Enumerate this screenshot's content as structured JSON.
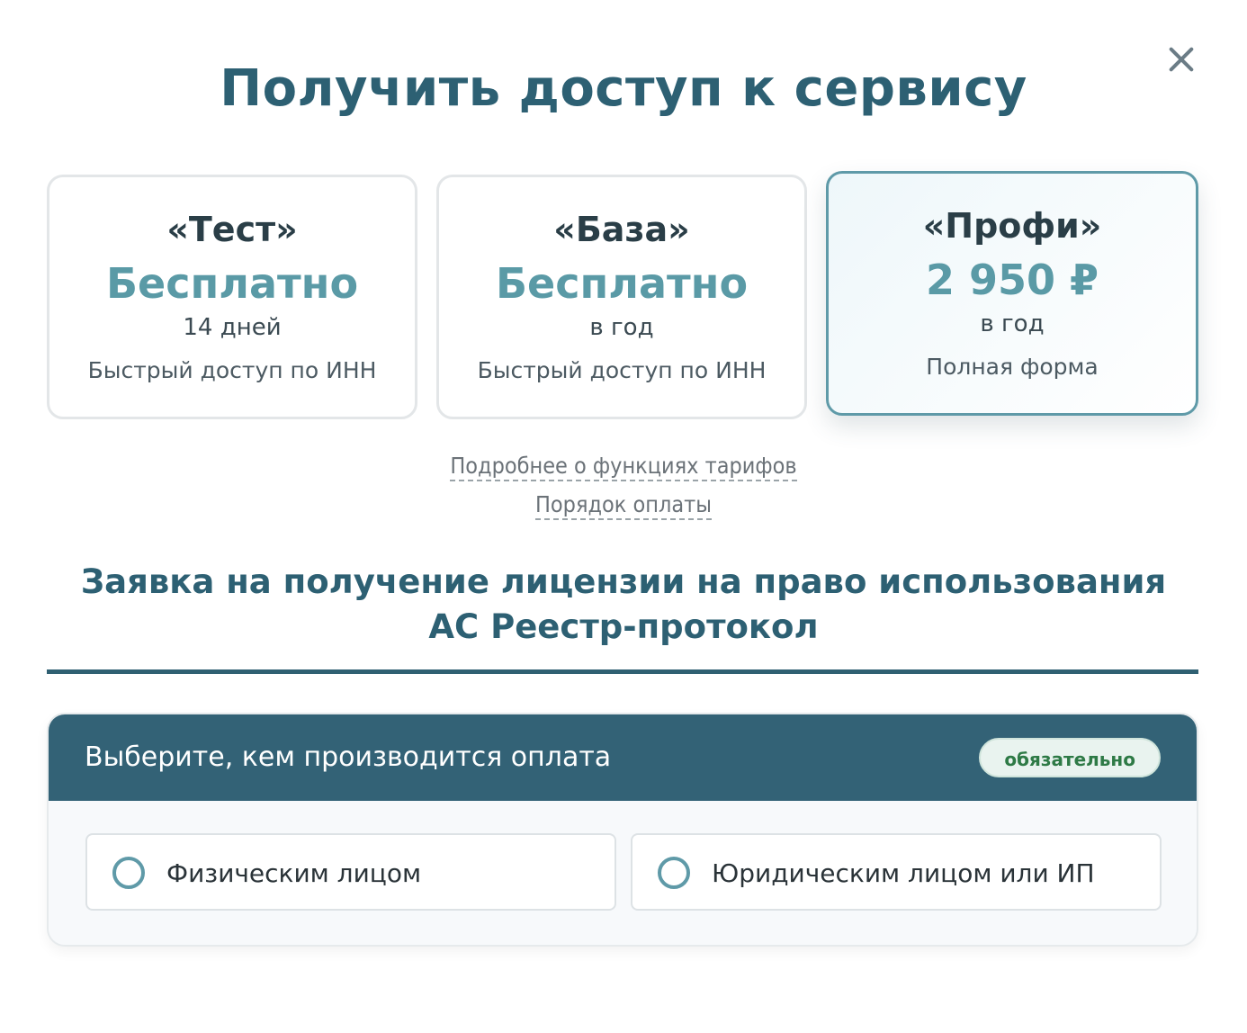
{
  "modal": {
    "title": "Получить доступ к сервису",
    "close_icon": "close-icon"
  },
  "plans": [
    {
      "name": "«Тест»",
      "price": "Бесплатно",
      "period": "14 дней",
      "desc": "Быстрый доступ по ИНН",
      "selected": false
    },
    {
      "name": "«База»",
      "price": "Бесплатно",
      "period": "в год",
      "desc": "Быстрый доступ по ИНН",
      "selected": false
    },
    {
      "name": "«Профи»",
      "price": "2 950 ₽",
      "period": "в год",
      "desc": "Полная форма",
      "selected": true
    }
  ],
  "links": {
    "features": "Подробнее о функциях тарифов",
    "payment": "Порядок оплаты"
  },
  "application": {
    "title_line1": "Заявка на получение лицензии на право использования",
    "title_line2": "АС Реестр-протокол"
  },
  "payer_section": {
    "heading": "Выберите, кем производится оплата",
    "badge": "обязательно",
    "options": [
      {
        "label": "Физическим лицом",
        "checked": false
      },
      {
        "label": "Юридическим лицом или ИП",
        "checked": false
      }
    ]
  },
  "colors": {
    "accent": "#2d6073",
    "price": "#5a9aa6",
    "header_bg": "#336276",
    "badge_text": "#2e7a46"
  }
}
